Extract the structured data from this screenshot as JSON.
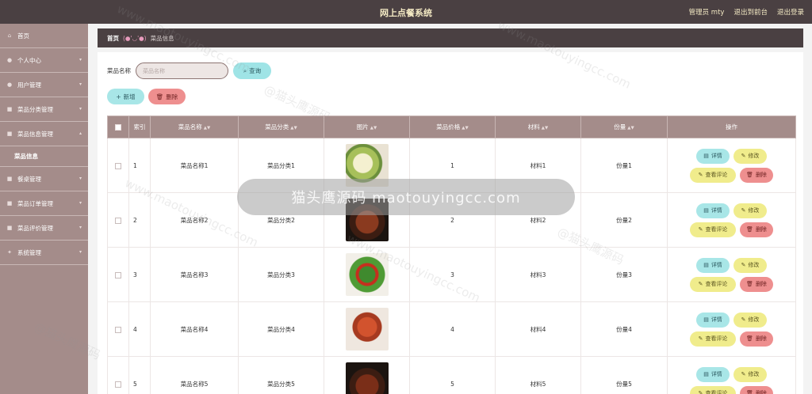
{
  "header": {
    "title": "网上点餐系统",
    "admin_label": "管理员 mty",
    "backend_label": "退出到前台",
    "logout_label": "退出登录"
  },
  "sidebar": {
    "items": [
      {
        "label": "首页",
        "icon": "home-icon"
      },
      {
        "label": "个人中心",
        "icon": "user-icon"
      },
      {
        "label": "用户管理",
        "icon": "users-icon"
      },
      {
        "label": "菜品分类管理",
        "icon": "category-icon"
      },
      {
        "label": "菜品信息管理",
        "icon": "dish-icon"
      },
      {
        "label": "餐桌管理",
        "icon": "table-icon"
      },
      {
        "label": "菜品订单管理",
        "icon": "order-icon"
      },
      {
        "label": "菜品评价管理",
        "icon": "review-icon"
      },
      {
        "label": "系统管理",
        "icon": "settings-icon"
      }
    ],
    "active_sub": "菜品信息"
  },
  "breadcrumb": {
    "home": "首页",
    "face": "(●'◡'●)",
    "current": "菜品信息"
  },
  "search": {
    "label": "菜品名称",
    "placeholder": "菜品名称",
    "query_label": "查询"
  },
  "actions": {
    "add_label": "新增",
    "delete_label": "删除"
  },
  "table": {
    "headers": [
      "索引",
      "菜品名称",
      "菜品分类",
      "图片",
      "菜品价格",
      "材料",
      "份量",
      "操作"
    ],
    "rows": [
      {
        "index": "1",
        "name": "菜品名称1",
        "category": "菜品分类1",
        "price": "1",
        "material": "材料1",
        "portion": "份量1"
      },
      {
        "index": "2",
        "name": "菜品名称2",
        "category": "菜品分类2",
        "price": "2",
        "material": "材料2",
        "portion": "份量2"
      },
      {
        "index": "3",
        "name": "菜品名称3",
        "category": "菜品分类3",
        "price": "3",
        "material": "材料3",
        "portion": "份量3"
      },
      {
        "index": "4",
        "name": "菜品名称4",
        "category": "菜品分类4",
        "price": "4",
        "material": "材料4",
        "portion": "份量4"
      },
      {
        "index": "5",
        "name": "菜品名称5",
        "category": "菜品分类5",
        "price": "5",
        "material": "材料5",
        "portion": "份量5"
      }
    ],
    "ops": {
      "detail": "详情",
      "edit": "修改",
      "comment": "查看评论",
      "remove": "删除"
    }
  },
  "overlay_text": "猫头鹰源码 maotouyingcc.com",
  "watermark": {
    "text_cn": "@猫头鹰源码",
    "text_en": "www.maotouyingcc.com"
  },
  "colors": {
    "topbar": "#4a4042",
    "sidebar": "#a48c8a",
    "accent_gold": "#f4eac4",
    "btn_cyan": "#a8e6e7",
    "btn_yellow": "#f0ec8c",
    "btn_red": "#ee8f8f"
  }
}
